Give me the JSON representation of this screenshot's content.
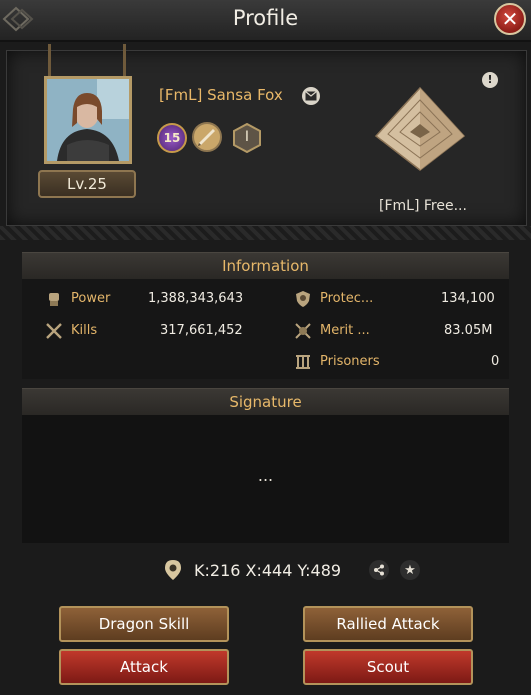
{
  "window": {
    "title": "Profile"
  },
  "player": {
    "name": "[FmL] Sansa Fox",
    "level": "Lv.25",
    "vip_level": "15",
    "rank_numeral": "I"
  },
  "alliance": {
    "name": "[FmL] Free..."
  },
  "information": {
    "header": "Information",
    "stats": [
      {
        "label": "Power",
        "value": "1,388,343,643",
        "icon": "fist-icon"
      },
      {
        "label": "Kills",
        "value": "317,661,452",
        "icon": "crossed-swords-icon"
      },
      {
        "label": "Protec...",
        "value": "134,100",
        "icon": "shield-icon"
      },
      {
        "label": "Merit ...",
        "value": "83.05M",
        "icon": "merit-icon"
      },
      {
        "label": "Prisoners",
        "value": "0",
        "icon": "prison-bars-icon"
      }
    ]
  },
  "signature": {
    "header": "Signature",
    "text": "..."
  },
  "location": {
    "coords": "K:216 X:444 Y:489"
  },
  "buttons": {
    "dragon_skill": "Dragon Skill",
    "rallied_attack": "Rallied Attack",
    "attack": "Attack",
    "scout": "Scout"
  },
  "colors": {
    "accent_gold": "#e7b86a",
    "button_brown": "#8e6138",
    "button_red": "#c0392b",
    "close_red": "#b02a22"
  }
}
